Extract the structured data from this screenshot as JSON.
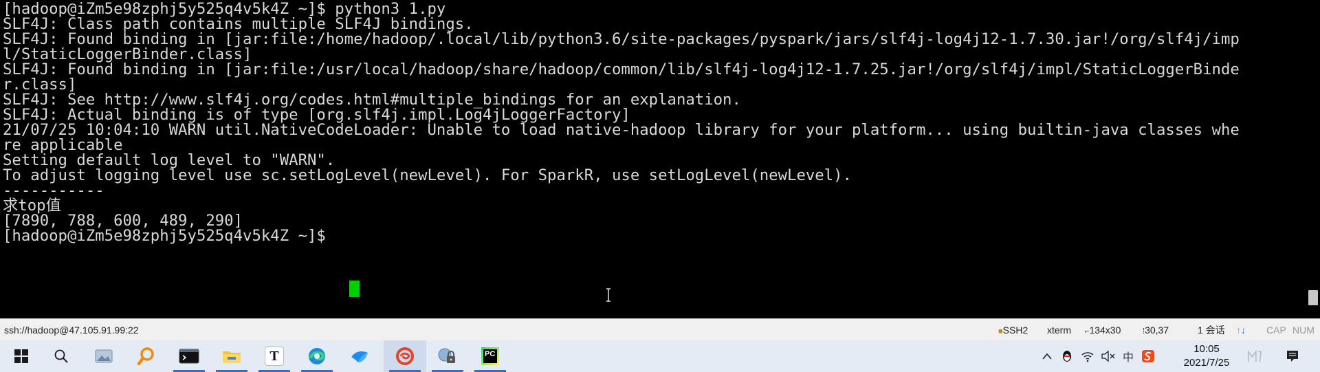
{
  "terminal": {
    "lines": [
      "[hadoop@iZm5e98zphj5y525q4v5k4Z ~]$ python3 1.py",
      "SLF4J: Class path contains multiple SLF4J bindings.",
      "SLF4J: Found binding in [jar:file:/home/hadoop/.local/lib/python3.6/site-packages/pyspark/jars/slf4j-log4j12-1.7.30.jar!/org/slf4j/imp",
      "l/StaticLoggerBinder.class]",
      "SLF4J: Found binding in [jar:file:/usr/local/hadoop/share/hadoop/common/lib/slf4j-log4j12-1.7.25.jar!/org/slf4j/impl/StaticLoggerBinde",
      "r.class]",
      "SLF4J: See http://www.slf4j.org/codes.html#multiple_bindings for an explanation.",
      "SLF4J: Actual binding is of type [org.slf4j.impl.Log4jLoggerFactory]",
      "21/07/25 10:04:10 WARN util.NativeCodeLoader: Unable to load native-hadoop library for your platform... using builtin-java classes whe",
      "re applicable",
      "Setting default log level to \"WARN\".",
      "To adjust logging level use sc.setLogLevel(newLevel). For SparkR, use setLogLevel(newLevel).",
      "-----------",
      "求top值",
      "[7890, 788, 600, 489, 290]",
      "[hadoop@iZm5e98zphj5y525q4v5k4Z ~]$ "
    ],
    "cursor_color": "#00d000"
  },
  "statusbar": {
    "connection": "ssh://hadoop@47.105.91.99:22",
    "protocol": "SSH2",
    "term_type": "xterm",
    "size": "134x30",
    "cursor_pos": "30,37",
    "sessions": "1 会话",
    "cap": "CAP",
    "num": "NUM"
  },
  "taskbar": {
    "apps": [
      {
        "name": "start-button",
        "icon": "windows-logo-icon"
      },
      {
        "name": "search-button",
        "icon": "search-icon"
      },
      {
        "name": "app-image-viewer",
        "icon": "image-viewer-icon"
      },
      {
        "name": "app-search-tool",
        "icon": "magnifier-orange-icon"
      },
      {
        "name": "app-terminal",
        "icon": "terminal-icon"
      },
      {
        "name": "app-file-explorer",
        "icon": "folder-icon"
      },
      {
        "name": "app-typora",
        "icon": "typora-t-icon",
        "label": "T"
      },
      {
        "name": "app-edge",
        "icon": "edge-icon"
      },
      {
        "name": "app-feishu",
        "icon": "feishu-icon"
      },
      {
        "name": "app-xshell",
        "icon": "xshell-icon"
      },
      {
        "name": "app-vpn",
        "icon": "lock-globe-icon"
      },
      {
        "name": "app-pycharm",
        "icon": "pycharm-icon",
        "label": "PC"
      }
    ],
    "tray": {
      "ime": "中",
      "clock_time": "10:05",
      "clock_date": "2021/7/25"
    }
  }
}
